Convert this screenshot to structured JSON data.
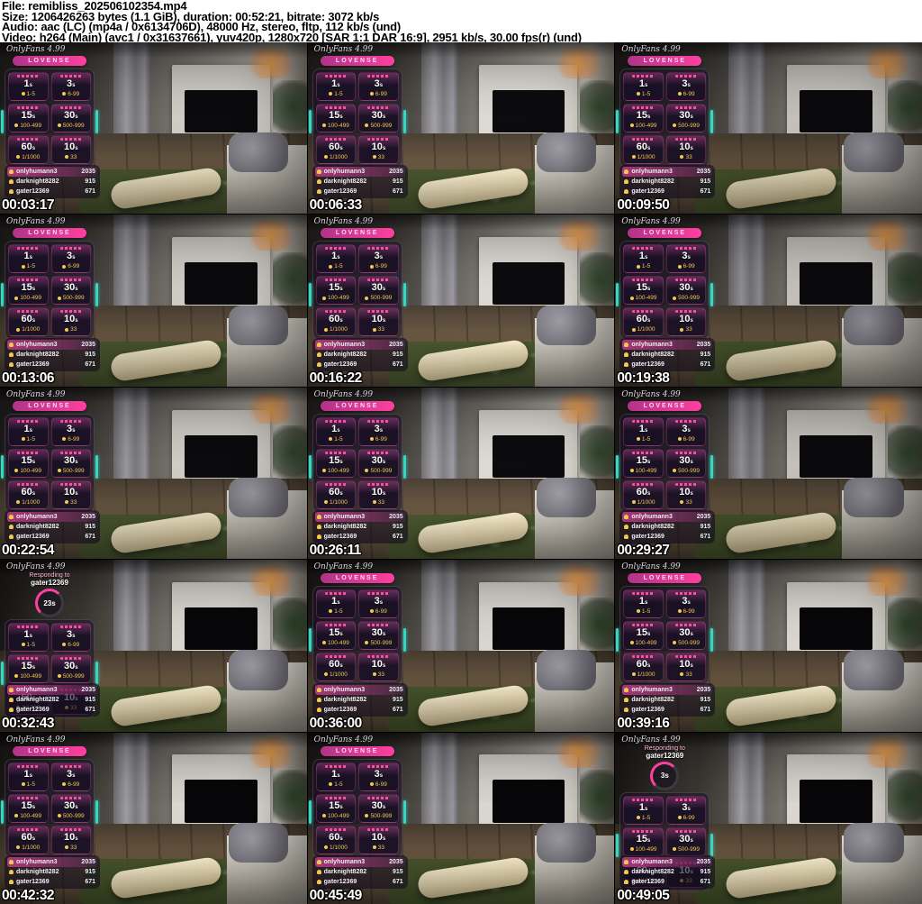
{
  "header": {
    "lines": [
      "File: remibliss_202506102354.mp4",
      "Size: 1206426263 bytes (1.1 GiB), duration: 00:52:21, bitrate: 3072 kb/s",
      "Audio: aac (LC) (mp4a / 0x6134706D), 48000 Hz, stereo, fltp, 112 kb/s (und)",
      "Video: h264 (Main) (avc1 / 0x31637661), yuv420p, 1280x720 [SAR 1:1 DAR 16:9], 2951 kb/s, 30.00 fps(r) (und)"
    ]
  },
  "thumbnails": {
    "timestamps": [
      "00:03:17",
      "00:06:33",
      "00:09:50",
      "00:13:06",
      "00:16:22",
      "00:19:38",
      "00:22:54",
      "00:26:11",
      "00:29:27",
      "00:32:43",
      "00:36:00",
      "00:39:16",
      "00:42:32",
      "00:45:49",
      "00:49:05"
    ]
  },
  "overlay": {
    "brand": "OnlyFans 4.99",
    "toy_label": "LOVENSE",
    "tip_tiles": [
      {
        "duration": "1",
        "unit": "s",
        "range": "1-5"
      },
      {
        "duration": "3",
        "unit": "s",
        "range": "6-99"
      },
      {
        "duration": "15",
        "unit": "s",
        "range": "100-499"
      },
      {
        "duration": "30",
        "unit": "s",
        "range": "500-999"
      },
      {
        "duration": "60",
        "unit": "s",
        "range": "1/1000"
      },
      {
        "duration": "10",
        "unit": "s",
        "range": "33"
      }
    ],
    "supporters": [
      {
        "name": "onlyhumann3",
        "amount": "2035"
      },
      {
        "name": "darknight8282",
        "amount": "915"
      },
      {
        "name": "gater12369",
        "amount": "671"
      }
    ],
    "responding": {
      "label": "Responding to",
      "user": "gater12369",
      "thumb_countdowns": {
        "9": "23s",
        "14": "3s"
      }
    }
  },
  "colors": {
    "accent_pink": "#ff3fa0",
    "gold": "#f2c94c",
    "teal": "#38d6c0",
    "timestamp_text": "#ffffff",
    "header_text": "#000000",
    "header_bg": "#ffffff"
  }
}
